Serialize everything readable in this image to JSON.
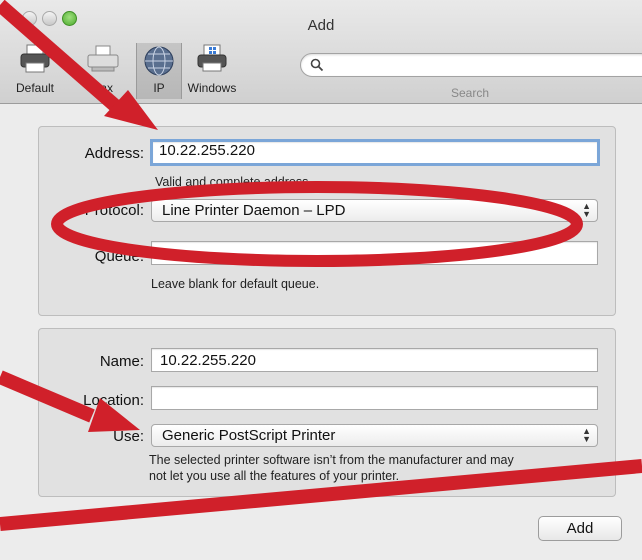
{
  "window": {
    "title": "Add"
  },
  "toolbar": {
    "items": [
      {
        "label": "Default"
      },
      {
        "label": "Fax"
      },
      {
        "label": "IP"
      },
      {
        "label": "Windows"
      }
    ],
    "search_label": "Search",
    "search_placeholder": ""
  },
  "ip_panel": {
    "address_label": "Address:",
    "address_value": "10.22.255.220",
    "address_hint": "Valid and complete address.",
    "protocol_label": "Protocol:",
    "protocol_value": "Line Printer Daemon – LPD",
    "queue_label": "Queue:",
    "queue_value": "",
    "queue_hint": "Leave blank for default queue."
  },
  "info_panel": {
    "name_label": "Name:",
    "name_value": "10.22.255.220",
    "location_label": "Location:",
    "location_value": "",
    "use_label": "Use:",
    "use_value": "Generic PostScript Printer",
    "use_hint_line1": "The selected printer software isn’t from the manufacturer and may",
    "use_hint_line2": "not let you use all the features of your printer."
  },
  "actions": {
    "add_label": "Add"
  },
  "annotation": {
    "color": "#d0202a"
  },
  "colors": {
    "focus": "#7ba6d8",
    "window_bg": "#ececec",
    "panel_bg": "#e1e1e1"
  }
}
